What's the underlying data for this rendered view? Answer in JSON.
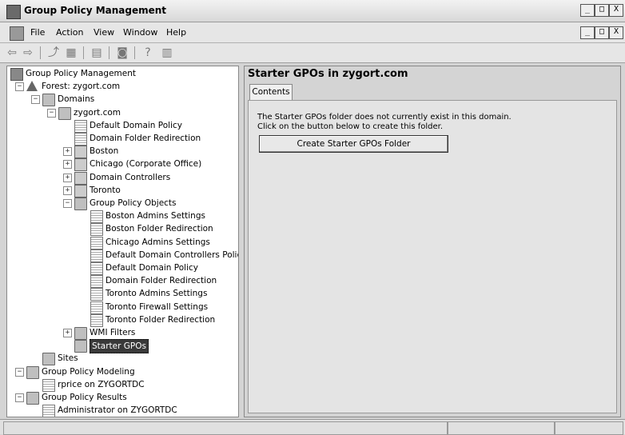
{
  "window": {
    "title": "Group Policy Management",
    "caption_buttons": [
      "_",
      "□",
      "X"
    ]
  },
  "menu": {
    "items": [
      "File",
      "Action",
      "View",
      "Window",
      "Help"
    ],
    "doc_buttons": [
      "_",
      "□",
      "X"
    ]
  },
  "toolbar": {
    "icons": [
      "back-arrow-icon",
      "forward-arrow-icon",
      "up-folder-icon",
      "show-tree-icon",
      "properties-icon",
      "refresh-icon",
      "help-icon",
      "action-pane-icon"
    ]
  },
  "tree": {
    "items": [
      {
        "label": "Group Policy Management",
        "level": 0,
        "icon": "console-icon",
        "expander": ""
      },
      {
        "label": "Forest: zygort.com",
        "level": 1,
        "icon": "forest-icon",
        "expander": "−"
      },
      {
        "label": "Domains",
        "level": 2,
        "icon": "domains-icon",
        "expander": "−"
      },
      {
        "label": "zygort.com",
        "level": 3,
        "icon": "domain-icon",
        "expander": "−"
      },
      {
        "label": "Default Domain Policy",
        "level": 4,
        "icon": "gpo-link-icon",
        "expander": ""
      },
      {
        "label": "Domain Folder Redirection",
        "level": 4,
        "icon": "gpo-link-icon",
        "expander": ""
      },
      {
        "label": "Boston",
        "level": 4,
        "icon": "ou-icon",
        "expander": "+"
      },
      {
        "label": "Chicago (Corporate Office)",
        "level": 4,
        "icon": "ou-blocked-icon",
        "expander": "+"
      },
      {
        "label": "Domain Controllers",
        "level": 4,
        "icon": "ou-icon",
        "expander": "+"
      },
      {
        "label": "Toronto",
        "level": 4,
        "icon": "ou-icon",
        "expander": "+"
      },
      {
        "label": "Group Policy Objects",
        "level": 4,
        "icon": "gpo-folder-icon",
        "expander": "−"
      },
      {
        "label": "Boston Admins Settings",
        "level": 5,
        "icon": "gpo-icon",
        "expander": ""
      },
      {
        "label": "Boston Folder Redirection",
        "level": 5,
        "icon": "gpo-icon",
        "expander": ""
      },
      {
        "label": "Chicago Admins Settings",
        "level": 5,
        "icon": "gpo-icon",
        "expander": ""
      },
      {
        "label": "Default Domain Controllers Policy",
        "level": 5,
        "icon": "gpo-icon",
        "expander": ""
      },
      {
        "label": "Default Domain Policy",
        "level": 5,
        "icon": "gpo-icon",
        "expander": ""
      },
      {
        "label": "Domain Folder Redirection",
        "level": 5,
        "icon": "gpo-icon",
        "expander": ""
      },
      {
        "label": "Toronto Admins Settings",
        "level": 5,
        "icon": "gpo-icon",
        "expander": ""
      },
      {
        "label": "Toronto Firewall Settings",
        "level": 5,
        "icon": "gpo-icon",
        "expander": ""
      },
      {
        "label": "Toronto Folder Redirection",
        "level": 5,
        "icon": "gpo-icon",
        "expander": ""
      },
      {
        "label": "WMI Filters",
        "level": 4,
        "icon": "wmi-folder-icon",
        "expander": "+"
      },
      {
        "label": "Starter GPOs",
        "level": 4,
        "icon": "starter-gpo-icon",
        "expander": "",
        "selected": true
      },
      {
        "label": "Sites",
        "level": 2,
        "icon": "sites-icon",
        "expander": ""
      },
      {
        "label": "Group Policy Modeling",
        "level": 1,
        "icon": "modeling-icon",
        "expander": "−"
      },
      {
        "label": "rprice on ZYGORTDC",
        "level": 2,
        "icon": "modeling-query-icon",
        "expander": ""
      },
      {
        "label": "Group Policy Results",
        "level": 1,
        "icon": "results-icon",
        "expander": "−"
      },
      {
        "label": "Administrator on ZYGORTDC",
        "level": 2,
        "icon": "results-query-icon",
        "expander": ""
      }
    ]
  },
  "content": {
    "title": "Starter GPOs in zygort.com",
    "tab": "Contents",
    "message_line1": "The Starter GPOs folder does not currently exist in this domain.",
    "message_line2": "Click on the button below to create this folder.",
    "button_label": "Create Starter GPOs Folder"
  }
}
